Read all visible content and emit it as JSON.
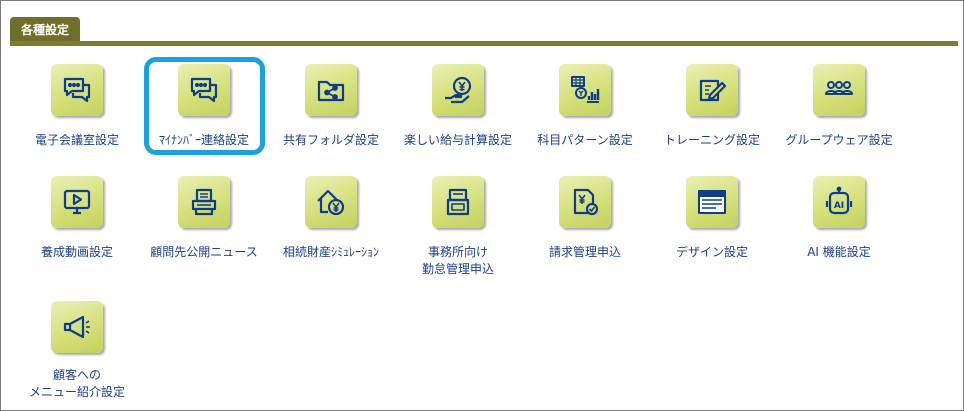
{
  "section": {
    "title": "各種設定"
  },
  "items": [
    {
      "label": "電子会議室設定",
      "icon": "chat-bubbles-icon"
    },
    {
      "label": "ﾏｲﾅﾝﾊﾞｰ連絡設定",
      "icon": "chat-bubbles-icon"
    },
    {
      "label": "共有フォルダ設定",
      "icon": "shared-folder-icon"
    },
    {
      "label": "楽しい給与計算設定",
      "icon": "payroll-yen-icon"
    },
    {
      "label": "科目パターン設定",
      "icon": "account-pattern-chart-icon"
    },
    {
      "label": "トレーニング設定",
      "icon": "training-edit-icon"
    },
    {
      "label": "グループウェア設定",
      "icon": "group-people-icon"
    },
    {
      "label": "養成動画設定",
      "icon": "video-monitor-icon"
    },
    {
      "label": "顧問先公開ニュース",
      "icon": "news-printer-icon"
    },
    {
      "label": "相続財産ｼﾐｭﾚｰｼｮﾝ",
      "icon": "house-yen-icon"
    },
    {
      "label": "事務所向け",
      "label2": "勤怠管理申込",
      "icon": "time-clock-icon"
    },
    {
      "label": "請求管理申込",
      "icon": "invoice-yen-icon"
    },
    {
      "label": "デザイン設定",
      "icon": "design-window-icon"
    },
    {
      "label": "AI 機能設定",
      "icon": "ai-robot-icon"
    },
    {
      "label": "顧客への",
      "label2": "メニュー紹介設定",
      "icon": "megaphone-icon"
    }
  ],
  "colors": {
    "accent_highlight": "#1aa2e0",
    "tab_bg": "#6f6f2a",
    "icon_stroke": "#0f3d8c",
    "label": "#1a3f8f"
  }
}
